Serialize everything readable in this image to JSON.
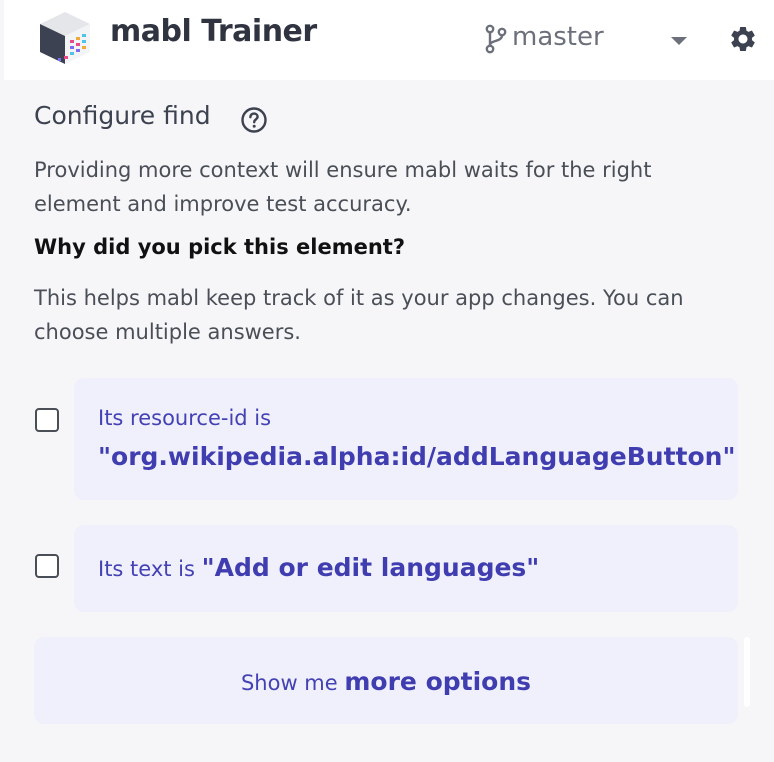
{
  "app": {
    "title": "mabl Trainer",
    "logo_icon": "mabl-cube-logo-icon",
    "branch": "master",
    "branch_icon": "git-branch-icon",
    "settings_icon": "gear-icon"
  },
  "section": {
    "title": "Configure find",
    "help_icon": "question-circle-icon",
    "description": "Providing more context will ensure mabl waits for the right element and improve test accuracy.",
    "question": "Why did you pick this element?",
    "hint": "This helps mabl keep track of it as your app changes. You can choose multiple answers."
  },
  "options": [
    {
      "prefix": "Its resource-id is",
      "value": "\"org.wikipedia.alpha:id/addLanguageButton\"",
      "checked": false
    },
    {
      "prefix": "Its text is",
      "value": "\"Add or edit languages\"",
      "checked": false
    }
  ],
  "more": {
    "prefix": "Show me",
    "emphasis": "more options"
  },
  "colors": {
    "accent": "#3f3db0",
    "card_bg": "#f0f0fc",
    "page_bg": "#f6f6f8",
    "header_bg": "#ffffff"
  }
}
